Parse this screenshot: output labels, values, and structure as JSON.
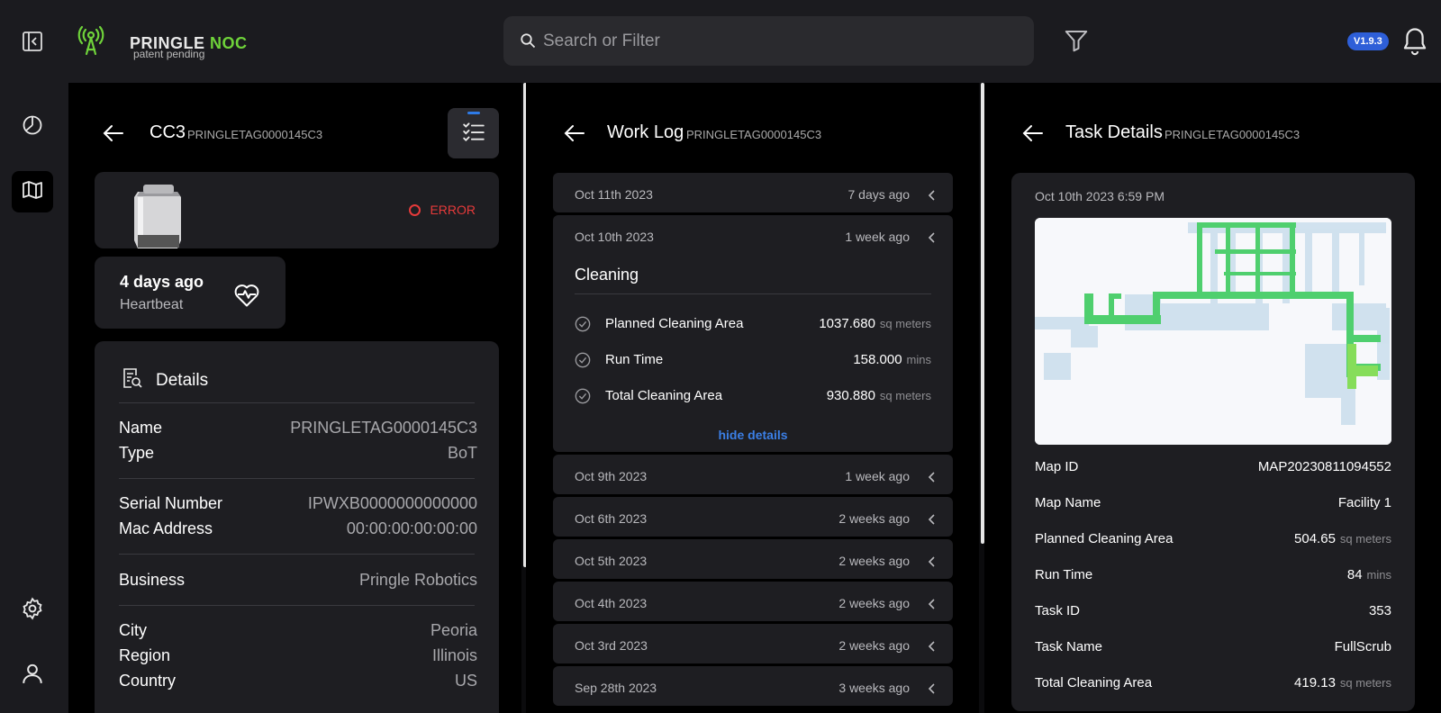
{
  "header": {
    "logo_primary": "PRINGLE",
    "logo_accent": "NOC",
    "logo_tagline": "patent pending",
    "search_placeholder": "Search or Filter",
    "version": "V1.9.3"
  },
  "colors": {
    "accent_green": "#6fd33a",
    "error_red": "#e53a3a",
    "link_blue": "#3b7fe6",
    "badge_blue": "#2e5fd8"
  },
  "icons": [
    "panel-toggle-icon",
    "signal-logo-icon",
    "search-icon",
    "filter-icon",
    "bell-icon",
    "dashboard-icon",
    "map-icon",
    "settings-icon",
    "user-icon",
    "back-arrow-icon",
    "checklist-icon",
    "heartbeat-icon",
    "report-search-icon",
    "check-circle-icon",
    "chevron-left-icon"
  ],
  "device": {
    "title": "CC3",
    "tag": "PRINGLETAG0000145C3",
    "status": "ERROR",
    "heartbeat_value": "4 days ago",
    "heartbeat_label": "Heartbeat",
    "details_title": "Details",
    "details": [
      {
        "label": "Name",
        "value": "PRINGLETAG0000145C3"
      },
      {
        "label": "Type",
        "value": "BoT"
      },
      {
        "label": "Serial Number",
        "value": "IPWXB0000000000000"
      },
      {
        "label": "Mac Address",
        "value": "00:00:00:00:00:00"
      },
      {
        "label": "Business",
        "value": "Pringle Robotics"
      },
      {
        "label": "City",
        "value": "Peoria"
      },
      {
        "label": "Region",
        "value": "Illinois"
      },
      {
        "label": "Country",
        "value": "US"
      }
    ]
  },
  "worklog": {
    "title": "Work Log",
    "tag": "PRINGLETAG0000145C3",
    "entries": [
      {
        "date": "Oct 11th 2023",
        "ago": "7 days ago"
      },
      {
        "date": "Oct 10th 2023",
        "ago": "1 week ago"
      },
      {
        "date": "Oct 9th 2023",
        "ago": "1 week ago"
      },
      {
        "date": "Oct 6th 2023",
        "ago": "2 weeks ago"
      },
      {
        "date": "Oct 5th 2023",
        "ago": "2 weeks ago"
      },
      {
        "date": "Oct 4th 2023",
        "ago": "2 weeks ago"
      },
      {
        "date": "Oct 3rd 2023",
        "ago": "2 weeks ago"
      },
      {
        "date": "Sep 28th 2023",
        "ago": "3 weeks ago"
      }
    ],
    "expanded": {
      "title": "Cleaning",
      "metrics": [
        {
          "label": "Planned Cleaning Area",
          "value": "1037.680",
          "unit": "sq meters"
        },
        {
          "label": "Run Time",
          "value": "158.000",
          "unit": "mins"
        },
        {
          "label": "Total Cleaning Area",
          "value": "930.880",
          "unit": "sq meters"
        }
      ],
      "hide_label": "hide details"
    }
  },
  "task": {
    "title": "Task Details",
    "tag": "PRINGLETAG0000145C3",
    "datetime": "Oct 10th 2023 6:59 PM",
    "rows": [
      {
        "label": "Map ID",
        "value": "MAP20230811094552",
        "unit": ""
      },
      {
        "label": "Map Name",
        "value": "Facility 1",
        "unit": ""
      },
      {
        "label": "Planned Cleaning Area",
        "value": "504.65",
        "unit": "sq meters"
      },
      {
        "label": "Run Time",
        "value": "84",
        "unit": "mins"
      },
      {
        "label": "Task ID",
        "value": "353",
        "unit": ""
      },
      {
        "label": "Task Name",
        "value": "FullScrub",
        "unit": ""
      },
      {
        "label": "Total Cleaning Area",
        "value": "419.13",
        "unit": "sq meters"
      }
    ]
  }
}
